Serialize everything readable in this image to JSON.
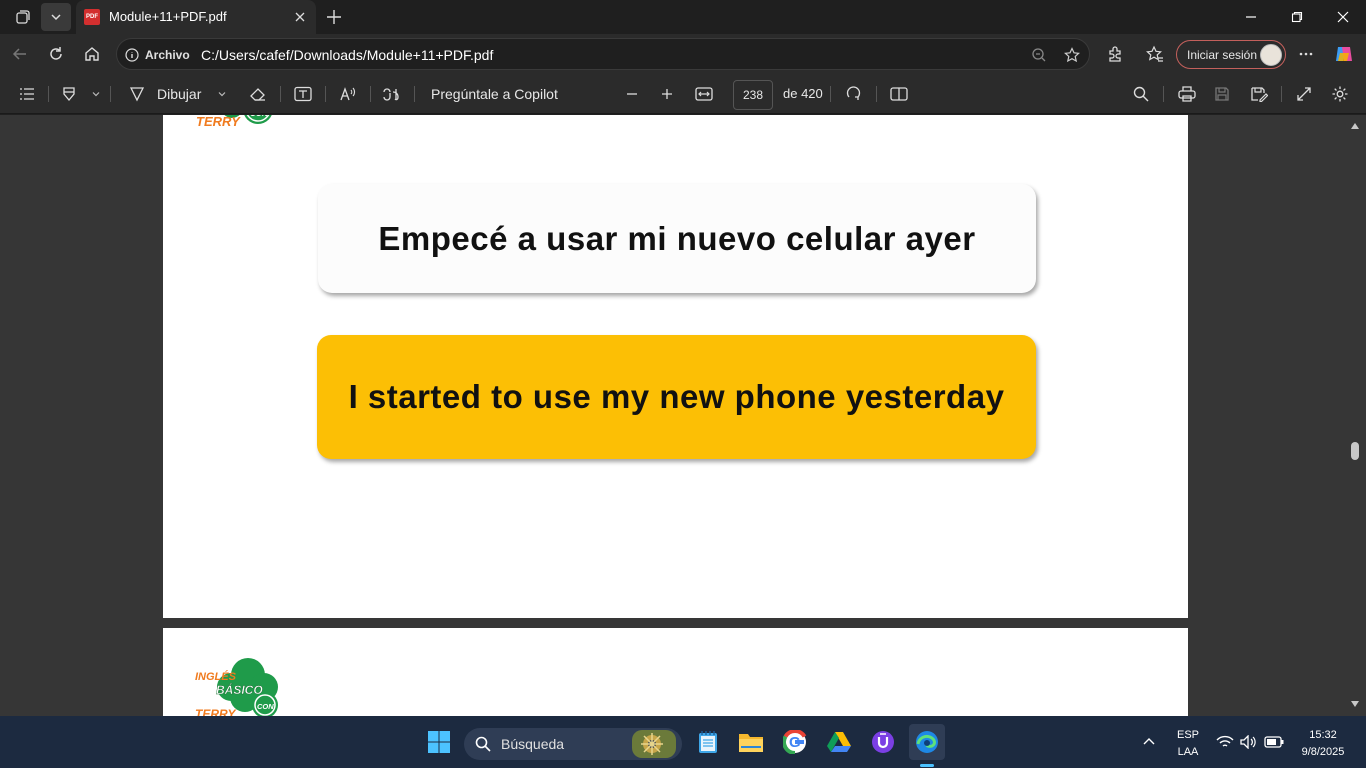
{
  "browser": {
    "tab_title": "Module+11+PDF.pdf",
    "favicon_text": "PDF",
    "address_pill": "Archivo",
    "url": "C:/Users/cafef/Downloads/Module+11+PDF.pdf",
    "signin_label": "Iniciar sesión"
  },
  "pdf_toolbar": {
    "draw_label": "Dibujar",
    "copilot_label": "Pregúntale a Copilot",
    "page_number": "238",
    "page_total": "de 420"
  },
  "document": {
    "spanish_sentence": "Empecé a usar mi nuevo celular ayer",
    "english_sentence": "I started to use my new phone yesterday",
    "logo_text_top": "TERRY",
    "logo_con": "CON",
    "logo_ingles": "INGLÉS",
    "logo_basico": "BÁSICO",
    "logo_terry": "TERRY",
    "highlight_color": "#fcbf05"
  },
  "taskbar": {
    "search_placeholder": "Búsqueda",
    "lang_top": "ESP",
    "lang_bottom": "LAA",
    "time": "15:32",
    "date": "9/8/2025"
  }
}
